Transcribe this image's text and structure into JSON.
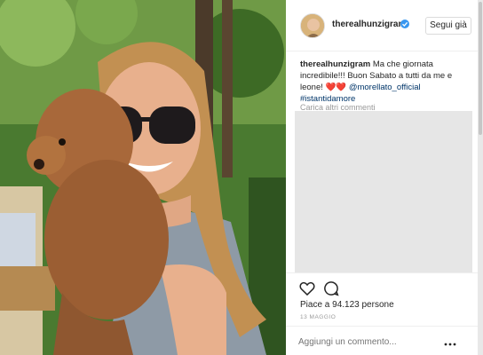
{
  "post": {
    "username": "therealhunzigram",
    "follow_label": "Segui già",
    "caption": {
      "username": "therealhunzigram",
      "text": "Ma che giornata incredibile!!! Buon Sabato a tutti da me e leone!",
      "emoji": "❤️❤️",
      "mention": "@morellato_official",
      "hashtag": "#istantidamore"
    },
    "load_more_label": "Carica altri commenti",
    "likes_label": "Piace a 94.123 persone",
    "date_label": "13 MAGGIO",
    "comment_placeholder": "Aggiungi un commento...",
    "colors": {
      "verified": "#3897f0",
      "link": "#003569",
      "text": "#262626",
      "muted": "#999999"
    },
    "icons": [
      "verified-badge-icon",
      "heart-icon",
      "comment-icon",
      "more-options-icon"
    ]
  }
}
